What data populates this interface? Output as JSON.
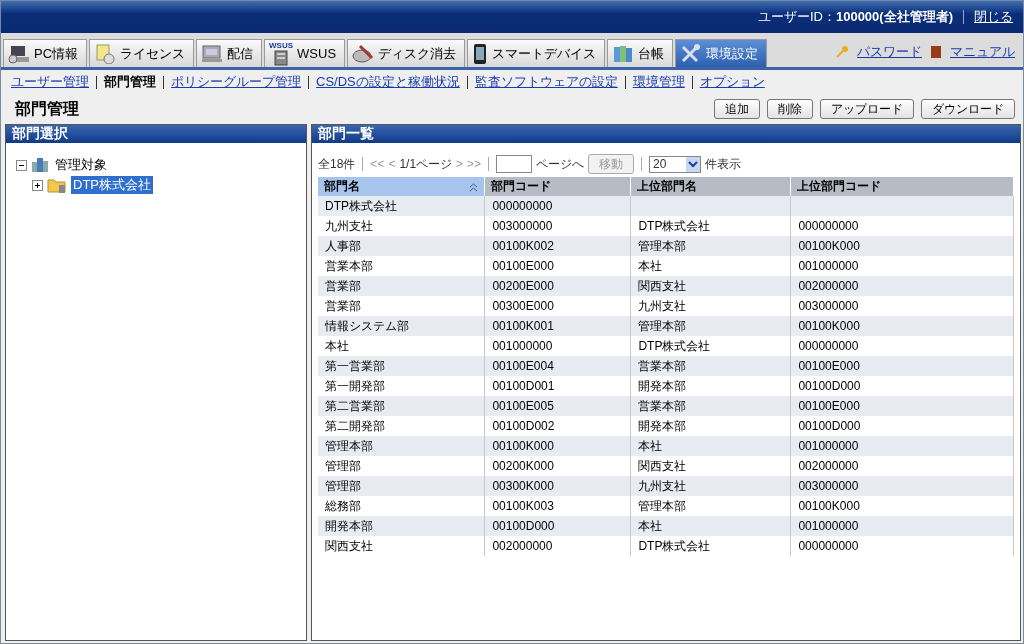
{
  "header": {
    "user_label": "ユーザーID：",
    "user_value": "100000(全社管理者)",
    "close": "閉じる"
  },
  "tabs": [
    {
      "label": "PC情報",
      "selected": false
    },
    {
      "label": "ライセンス",
      "selected": false
    },
    {
      "label": "配信",
      "selected": false
    },
    {
      "label": "WSUS",
      "icon_label": "WSUS",
      "selected": false
    },
    {
      "label": "ディスク消去",
      "selected": false
    },
    {
      "label": "スマートデバイス",
      "selected": false
    },
    {
      "label": "台帳",
      "selected": false
    },
    {
      "label": "環境設定",
      "selected": true
    }
  ],
  "top_links": [
    "パスワード",
    "マニュアル"
  ],
  "subnav": [
    {
      "label": "ユーザー管理",
      "selected": false
    },
    {
      "label": "部門管理",
      "selected": true
    },
    {
      "label": "ポリシーグループ管理",
      "selected": false
    },
    {
      "label": "CS/DSの設定と稼働状況",
      "selected": false
    },
    {
      "label": "監査ソフトウェアの設定",
      "selected": false
    },
    {
      "label": "環境管理",
      "selected": false
    },
    {
      "label": "オプション",
      "selected": false
    }
  ],
  "page_title": "部門管理",
  "actions": [
    "追加",
    "削除",
    "アップロード",
    "ダウンロード"
  ],
  "left_panel": {
    "title": "部門選択",
    "tree": [
      {
        "label": "管理対象",
        "expanded": true,
        "selected": false,
        "children": [
          {
            "label": "DTP株式会社",
            "expanded": false,
            "selected": true
          }
        ]
      }
    ]
  },
  "right_panel": {
    "title": "部門一覧",
    "pager": {
      "total": "全18件",
      "first": "<<",
      "prev": "<",
      "page": "1/1ページ",
      "next": ">",
      "last": ">>",
      "goto_suffix": "ページへ",
      "goto_button": "移動",
      "per_page": "20",
      "per_page_suffix": "件表示"
    },
    "table": {
      "columns": [
        {
          "label": "部門名",
          "sorted": true
        },
        {
          "label": "部門コード",
          "sorted": false
        },
        {
          "label": "上位部門名",
          "sorted": false
        },
        {
          "label": "上位部門コード",
          "sorted": false
        }
      ],
      "rows": [
        [
          "DTP株式会社",
          "000000000",
          "",
          ""
        ],
        [
          "九州支社",
          "003000000",
          "DTP株式会社",
          "000000000"
        ],
        [
          "人事部",
          "00100K002",
          "管理本部",
          "00100K000"
        ],
        [
          "営業本部",
          "00100E000",
          "本社",
          "001000000"
        ],
        [
          "営業部",
          "00200E000",
          "関西支社",
          "002000000"
        ],
        [
          "営業部",
          "00300E000",
          "九州支社",
          "003000000"
        ],
        [
          "情報システム部",
          "00100K001",
          "管理本部",
          "00100K000"
        ],
        [
          "本社",
          "001000000",
          "DTP株式会社",
          "000000000"
        ],
        [
          "第一営業部",
          "00100E004",
          "営業本部",
          "00100E000"
        ],
        [
          "第一開発部",
          "00100D001",
          "開発本部",
          "00100D000"
        ],
        [
          "第二営業部",
          "00100E005",
          "営業本部",
          "00100E000"
        ],
        [
          "第二開発部",
          "00100D002",
          "開発本部",
          "00100D000"
        ],
        [
          "管理本部",
          "00100K000",
          "本社",
          "001000000"
        ],
        [
          "管理部",
          "00200K000",
          "関西支社",
          "002000000"
        ],
        [
          "管理部",
          "00300K000",
          "九州支社",
          "003000000"
        ],
        [
          "総務部",
          "00100K003",
          "管理本部",
          "00100K000"
        ],
        [
          "開発本部",
          "00100D000",
          "本社",
          "001000000"
        ],
        [
          "関西支社",
          "002000000",
          "DTP株式会社",
          "000000000"
        ]
      ]
    }
  }
}
